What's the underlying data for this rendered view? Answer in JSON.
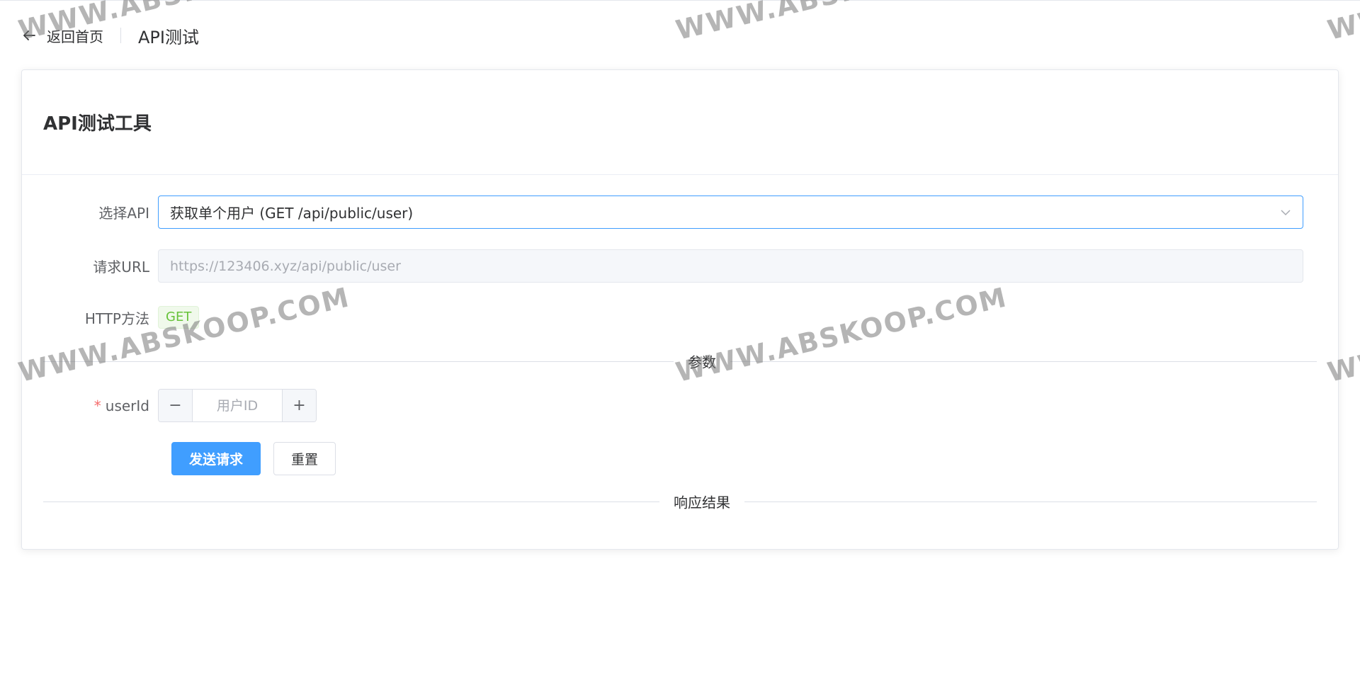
{
  "header": {
    "back_label": "返回首页",
    "title": "API测试"
  },
  "card": {
    "title": "API测试工具"
  },
  "form": {
    "api_label": "选择API",
    "api_selected": "获取单个用户 (GET /api/public/user)",
    "url_label": "请求URL",
    "url_value": "https://123406.xyz/api/public/user",
    "method_label": "HTTP方法",
    "method_value": "GET",
    "params_divider": "参数",
    "userid_label": "userId",
    "userid_required": "*",
    "userid_placeholder": "用户ID",
    "minus": "−",
    "plus": "+",
    "send_label": "发送请求",
    "reset_label": "重置",
    "response_divider": "响应结果"
  },
  "watermark": {
    "text": "WWW.ABSKOOP.COM"
  },
  "colors": {
    "primary": "#409eff",
    "required": "#f56c6c",
    "tag_green": "#67c23a"
  }
}
